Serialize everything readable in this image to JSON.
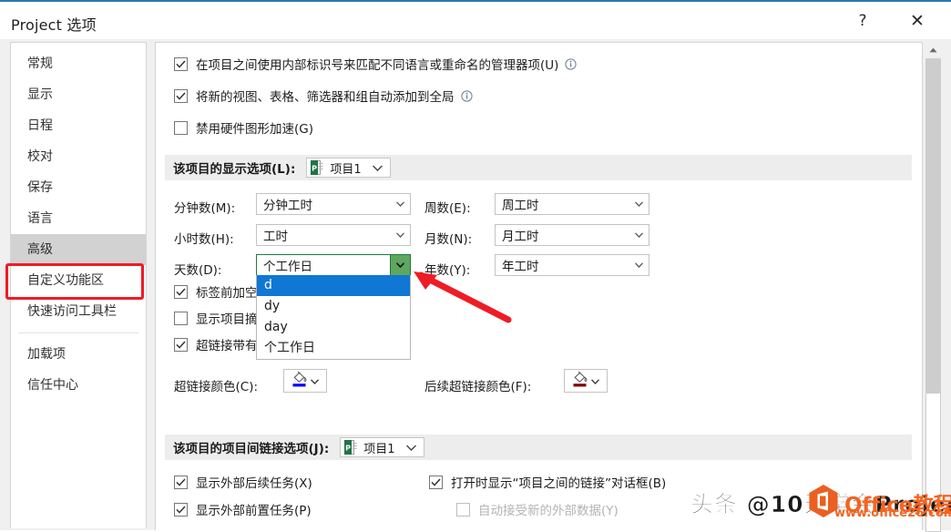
{
  "window": {
    "title": "Project 选项",
    "help_label": "?",
    "close_label": "✕"
  },
  "sidebar": {
    "items": [
      {
        "label": "常规",
        "selected": false
      },
      {
        "label": "显示",
        "selected": false
      },
      {
        "label": "日程",
        "selected": false
      },
      {
        "label": "校对",
        "selected": false
      },
      {
        "label": "保存",
        "selected": false
      },
      {
        "label": "语言",
        "selected": false
      },
      {
        "label": "高级",
        "selected": true
      },
      {
        "label": "自定义功能区",
        "selected": false
      },
      {
        "label": "快速访问工具栏",
        "selected": false
      },
      {
        "label": "加载项",
        "selected": false
      },
      {
        "label": "信任中心",
        "selected": false
      }
    ]
  },
  "pane": {
    "top_checkboxes": [
      {
        "label": "在项目之间使用内部标识号来匹配不同语言或重命名的管理器项(U)",
        "checked": true,
        "info": true
      },
      {
        "label": "将新的视图、表格、筛选器和组自动添加到全局",
        "checked": true,
        "info": true
      },
      {
        "label": "禁用硬件图形加速(G)",
        "checked": false,
        "info": false
      }
    ],
    "display_section": {
      "title": "该项目的显示选项(L):",
      "project_name": "项目1",
      "fields": [
        {
          "label": "分钟数(M):",
          "value": "分钟工时"
        },
        {
          "label": "小时数(H):",
          "value": "工时"
        },
        {
          "label": "天数(D):",
          "value": "个工作日"
        },
        {
          "label": "周数(E):",
          "value": "周工时"
        },
        {
          "label": "月数(N):",
          "value": "月工时"
        },
        {
          "label": "年数(Y):",
          "value": "年工时"
        }
      ],
      "day_dropdown_options": [
        {
          "label": "d",
          "selected": true
        },
        {
          "label": "dy",
          "selected": false
        },
        {
          "label": "day",
          "selected": false
        },
        {
          "label": "个工作日",
          "selected": false
        }
      ],
      "checkboxes": [
        {
          "label": "标签前加空格(S)",
          "checked": true
        },
        {
          "label": "显示项目摘要任务(T)",
          "checked": false
        },
        {
          "label": "超链接带有下划线(R)",
          "checked": true
        }
      ],
      "hyperlink_color_label": "超链接颜色(C):",
      "hyperlink_color": "#0000ff",
      "followed_hyperlink_color_label": "后续超链接颜色(F):",
      "followed_hyperlink_color": "#800000"
    },
    "crossproject_section": {
      "title": "该项目的项目间链接选项(J):",
      "project_name": "项目1",
      "checkboxes": [
        {
          "label": "显示外部后续任务(X)",
          "checked": true,
          "disabled": false
        },
        {
          "label": "显示外部前置任务(P)",
          "checked": true,
          "disabled": false
        },
        {
          "label": "打开时显示“项目之间的链接”对话框(B)",
          "checked": true,
          "disabled": false
        },
        {
          "label": "自动接受新的外部数据(Y)",
          "checked": false,
          "disabled": true
        }
      ]
    }
  },
  "watermarks": {
    "toutiao": "头条 @10天学会Project",
    "office_title": "Office教程网",
    "office_url": "www.office26.com"
  },
  "colors": {
    "accent": "#2a7ab0",
    "selection": "#1077d4",
    "annotation": "#ee1c25",
    "open_combo": "#5ea75e"
  }
}
